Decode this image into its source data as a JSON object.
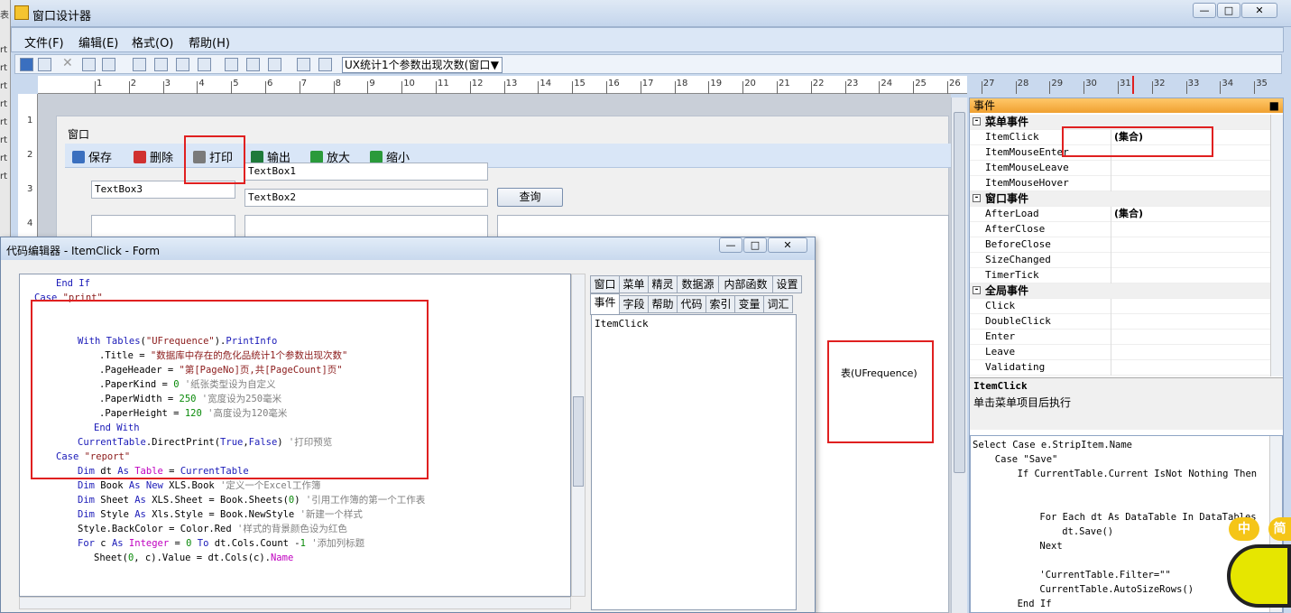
{
  "app": {
    "title": "窗口设计器",
    "left_strip": [
      "表",
      "rt",
      "rt",
      "rt",
      "rt",
      "rt",
      "rt",
      "rt",
      "rt"
    ]
  },
  "menubar": {
    "items": [
      "文件(F)",
      "编辑(E)",
      "格式(O)",
      "帮助(H)"
    ]
  },
  "toolbar": {
    "combo_value": "UX统计1个参数出现次数(窗口"
  },
  "ruler": {
    "h_ticks": [
      "1",
      "2",
      "3",
      "4",
      "5",
      "6",
      "7",
      "8",
      "9",
      "10",
      "11",
      "12",
      "13",
      "14",
      "15",
      "16",
      "17",
      "18",
      "19",
      "20",
      "21",
      "22",
      "23",
      "24",
      "25",
      "26",
      "27",
      "28",
      "29",
      "30",
      "31",
      "32",
      "33",
      "34",
      "35"
    ],
    "v_ticks": [
      "1",
      "2",
      "3",
      "4"
    ]
  },
  "form": {
    "title": "窗口",
    "toolbar_buttons": [
      {
        "label": "保存",
        "icon": "save-icon",
        "color": "#3a6fbf"
      },
      {
        "label": "删除",
        "icon": "delete-icon",
        "color": "#d03030"
      },
      {
        "label": "打印",
        "icon": "print-icon",
        "color": "#7a7a7a"
      },
      {
        "label": "输出",
        "icon": "excel-icon",
        "color": "#1e7a3a"
      },
      {
        "label": "放大",
        "icon": "zoom-in-icon",
        "color": "#2a9a3a"
      },
      {
        "label": "缩小",
        "icon": "zoom-out-icon",
        "color": "#2a9a3a"
      }
    ],
    "textbox1": "TextBox1",
    "textbox2": "TextBox2",
    "textbox3": "TextBox3",
    "query_button": "查询",
    "table_label": "表(UFrequence)"
  },
  "editor": {
    "title": "代码编辑器 - ItemClick - Form",
    "tabs_row1": [
      "窗口",
      "菜单",
      "精灵",
      "数据源",
      "内部函数",
      "设置"
    ],
    "tabs_row2": [
      "事件",
      "字段",
      "帮助",
      "代码",
      "索引",
      "变量",
      "词汇"
    ],
    "tab_list_item": "ItemClick",
    "code": [
      {
        "indent": 6,
        "parts": [
          [
            "kw",
            "End If"
          ]
        ]
      },
      {
        "indent": 2,
        "parts": [
          [
            "kw",
            "Case "
          ],
          [
            "str",
            "\"print\""
          ]
        ]
      },
      {
        "indent": 0,
        "parts": []
      },
      {
        "indent": 0,
        "parts": []
      },
      {
        "indent": 10,
        "parts": [
          [
            "kw",
            "With "
          ],
          [
            "kw",
            "Tables"
          ],
          [
            "",
            "("
          ],
          [
            "str",
            "\"UFrequence\""
          ],
          [
            "",
            ")."
          ],
          [
            "kw",
            "PrintInfo"
          ]
        ]
      },
      {
        "indent": 14,
        "parts": [
          [
            "",
            ".Title = "
          ],
          [
            "str",
            "\"数据库中存在的危化品统计1个参数出现次数\""
          ]
        ]
      },
      {
        "indent": 14,
        "parts": [
          [
            "",
            ".PageHeader = "
          ],
          [
            "str",
            "\"第[PageNo]页,共[PageCount]页\""
          ]
        ]
      },
      {
        "indent": 14,
        "parts": [
          [
            "",
            ".PaperKind = "
          ],
          [
            "num",
            "0"
          ],
          [
            "cm",
            " '纸张类型设为自定义"
          ]
        ]
      },
      {
        "indent": 14,
        "parts": [
          [
            "",
            ".PaperWidth = "
          ],
          [
            "num",
            "250"
          ],
          [
            "cm",
            " '宽度设为250毫米"
          ]
        ]
      },
      {
        "indent": 14,
        "parts": [
          [
            "",
            ".PaperHeight = "
          ],
          [
            "num",
            "120"
          ],
          [
            "cm",
            " '高度设为120毫米"
          ]
        ]
      },
      {
        "indent": 13,
        "parts": [
          [
            "kw",
            "End With"
          ]
        ]
      },
      {
        "indent": 10,
        "parts": [
          [
            "kw",
            "CurrentTable"
          ],
          [
            "",
            ".DirectPrint("
          ],
          [
            "kw",
            "True"
          ],
          [
            "",
            ","
          ],
          [
            "kw",
            "False"
          ],
          [
            "",
            ")"
          ],
          [
            "cm",
            " '打印预览"
          ]
        ]
      },
      {
        "indent": 6,
        "parts": [
          [
            "kw",
            "Case "
          ],
          [
            "str",
            "\"report\""
          ]
        ]
      },
      {
        "indent": 10,
        "parts": [
          [
            "kw",
            "Dim "
          ],
          [
            "",
            "dt "
          ],
          [
            "kw",
            "As "
          ],
          [
            "ty",
            "Table"
          ],
          [
            "",
            " = "
          ],
          [
            "kw",
            "CurrentTable"
          ]
        ]
      },
      {
        "indent": 10,
        "parts": [
          [
            "kw",
            "Dim "
          ],
          [
            "",
            "Book "
          ],
          [
            "kw",
            "As New "
          ],
          [
            "",
            "XLS.Book "
          ],
          [
            "cm",
            "'定义一个Excel工作簿"
          ]
        ]
      },
      {
        "indent": 10,
        "parts": [
          [
            "kw",
            "Dim "
          ],
          [
            "",
            "Sheet "
          ],
          [
            "kw",
            "As "
          ],
          [
            "",
            "XLS.Sheet = Book.Sheets("
          ],
          [
            "num",
            "0"
          ],
          [
            "",
            ") "
          ],
          [
            "cm",
            "'引用工作簿的第一个工作表"
          ]
        ]
      },
      {
        "indent": 10,
        "parts": [
          [
            "kw",
            "Dim "
          ],
          [
            "",
            "Style "
          ],
          [
            "kw",
            "As "
          ],
          [
            "",
            "Xls.Style = Book.NewStyle "
          ],
          [
            "cm",
            "'新建一个样式"
          ]
        ]
      },
      {
        "indent": 10,
        "parts": [
          [
            "",
            "Style.BackColor = Color.Red "
          ],
          [
            "cm",
            "'样式的背景颜色设为红色"
          ]
        ]
      },
      {
        "indent": 10,
        "parts": [
          [
            "kw",
            "For "
          ],
          [
            "",
            "c "
          ],
          [
            "kw",
            "As "
          ],
          [
            "ty",
            "Integer"
          ],
          [
            "",
            " = "
          ],
          [
            "num",
            "0"
          ],
          [
            "kw",
            " To "
          ],
          [
            "",
            "dt.Cols.Count -"
          ],
          [
            "num",
            "1"
          ],
          [
            "cm",
            " '添加列标题"
          ]
        ]
      },
      {
        "indent": 13,
        "parts": [
          [
            "",
            "Sheet("
          ],
          [
            "num",
            "0"
          ],
          [
            "",
            ", c).Value = dt.Cols(c)."
          ],
          [
            "ty",
            "Name"
          ]
        ]
      }
    ]
  },
  "props": {
    "header": "事件",
    "rows": [
      {
        "cat": true,
        "name": "菜单事件"
      },
      {
        "cat": false,
        "name": "ItemClick",
        "value": "(集合)"
      },
      {
        "cat": false,
        "name": "ItemMouseEnter",
        "value": ""
      },
      {
        "cat": false,
        "name": "ItemMouseLeave",
        "value": ""
      },
      {
        "cat": false,
        "name": "ItemMouseHover",
        "value": ""
      },
      {
        "cat": true,
        "name": "窗口事件"
      },
      {
        "cat": false,
        "name": "AfterLoad",
        "value": "(集合)"
      },
      {
        "cat": false,
        "name": "AfterClose",
        "value": ""
      },
      {
        "cat": false,
        "name": "BeforeClose",
        "value": ""
      },
      {
        "cat": false,
        "name": "SizeChanged",
        "value": ""
      },
      {
        "cat": false,
        "name": "TimerTick",
        "value": ""
      },
      {
        "cat": true,
        "name": "全局事件"
      },
      {
        "cat": false,
        "name": "Click",
        "value": ""
      },
      {
        "cat": false,
        "name": "DoubleClick",
        "value": ""
      },
      {
        "cat": false,
        "name": "Enter",
        "value": ""
      },
      {
        "cat": false,
        "name": "Leave",
        "value": ""
      },
      {
        "cat": false,
        "name": "Validating",
        "value": ""
      }
    ],
    "desc_title": "ItemClick",
    "desc_text": "单击菜单项目后执行"
  },
  "snippet": {
    "lines": [
      {
        "indent": 0,
        "text": "Select Case e.StripItem.Name"
      },
      {
        "indent": 4,
        "text": "Case \"Save\""
      },
      {
        "indent": 8,
        "text": "If CurrentTable.Current IsNot Nothing Then"
      },
      {
        "indent": 0,
        "text": ""
      },
      {
        "indent": 0,
        "text": ""
      },
      {
        "indent": 12,
        "text": "For Each dt As DataTable In DataTables"
      },
      {
        "indent": 16,
        "text": "dt.Save()"
      },
      {
        "indent": 12,
        "text": "Next"
      },
      {
        "indent": 0,
        "text": ""
      },
      {
        "indent": 12,
        "text": "'CurrentTable.Filter=\"\""
      },
      {
        "indent": 12,
        "text": "CurrentTable.AutoSizeRows()"
      },
      {
        "indent": 8,
        "text": "End If"
      }
    ]
  },
  "ime": {
    "label1": "中",
    "label2": "简"
  }
}
